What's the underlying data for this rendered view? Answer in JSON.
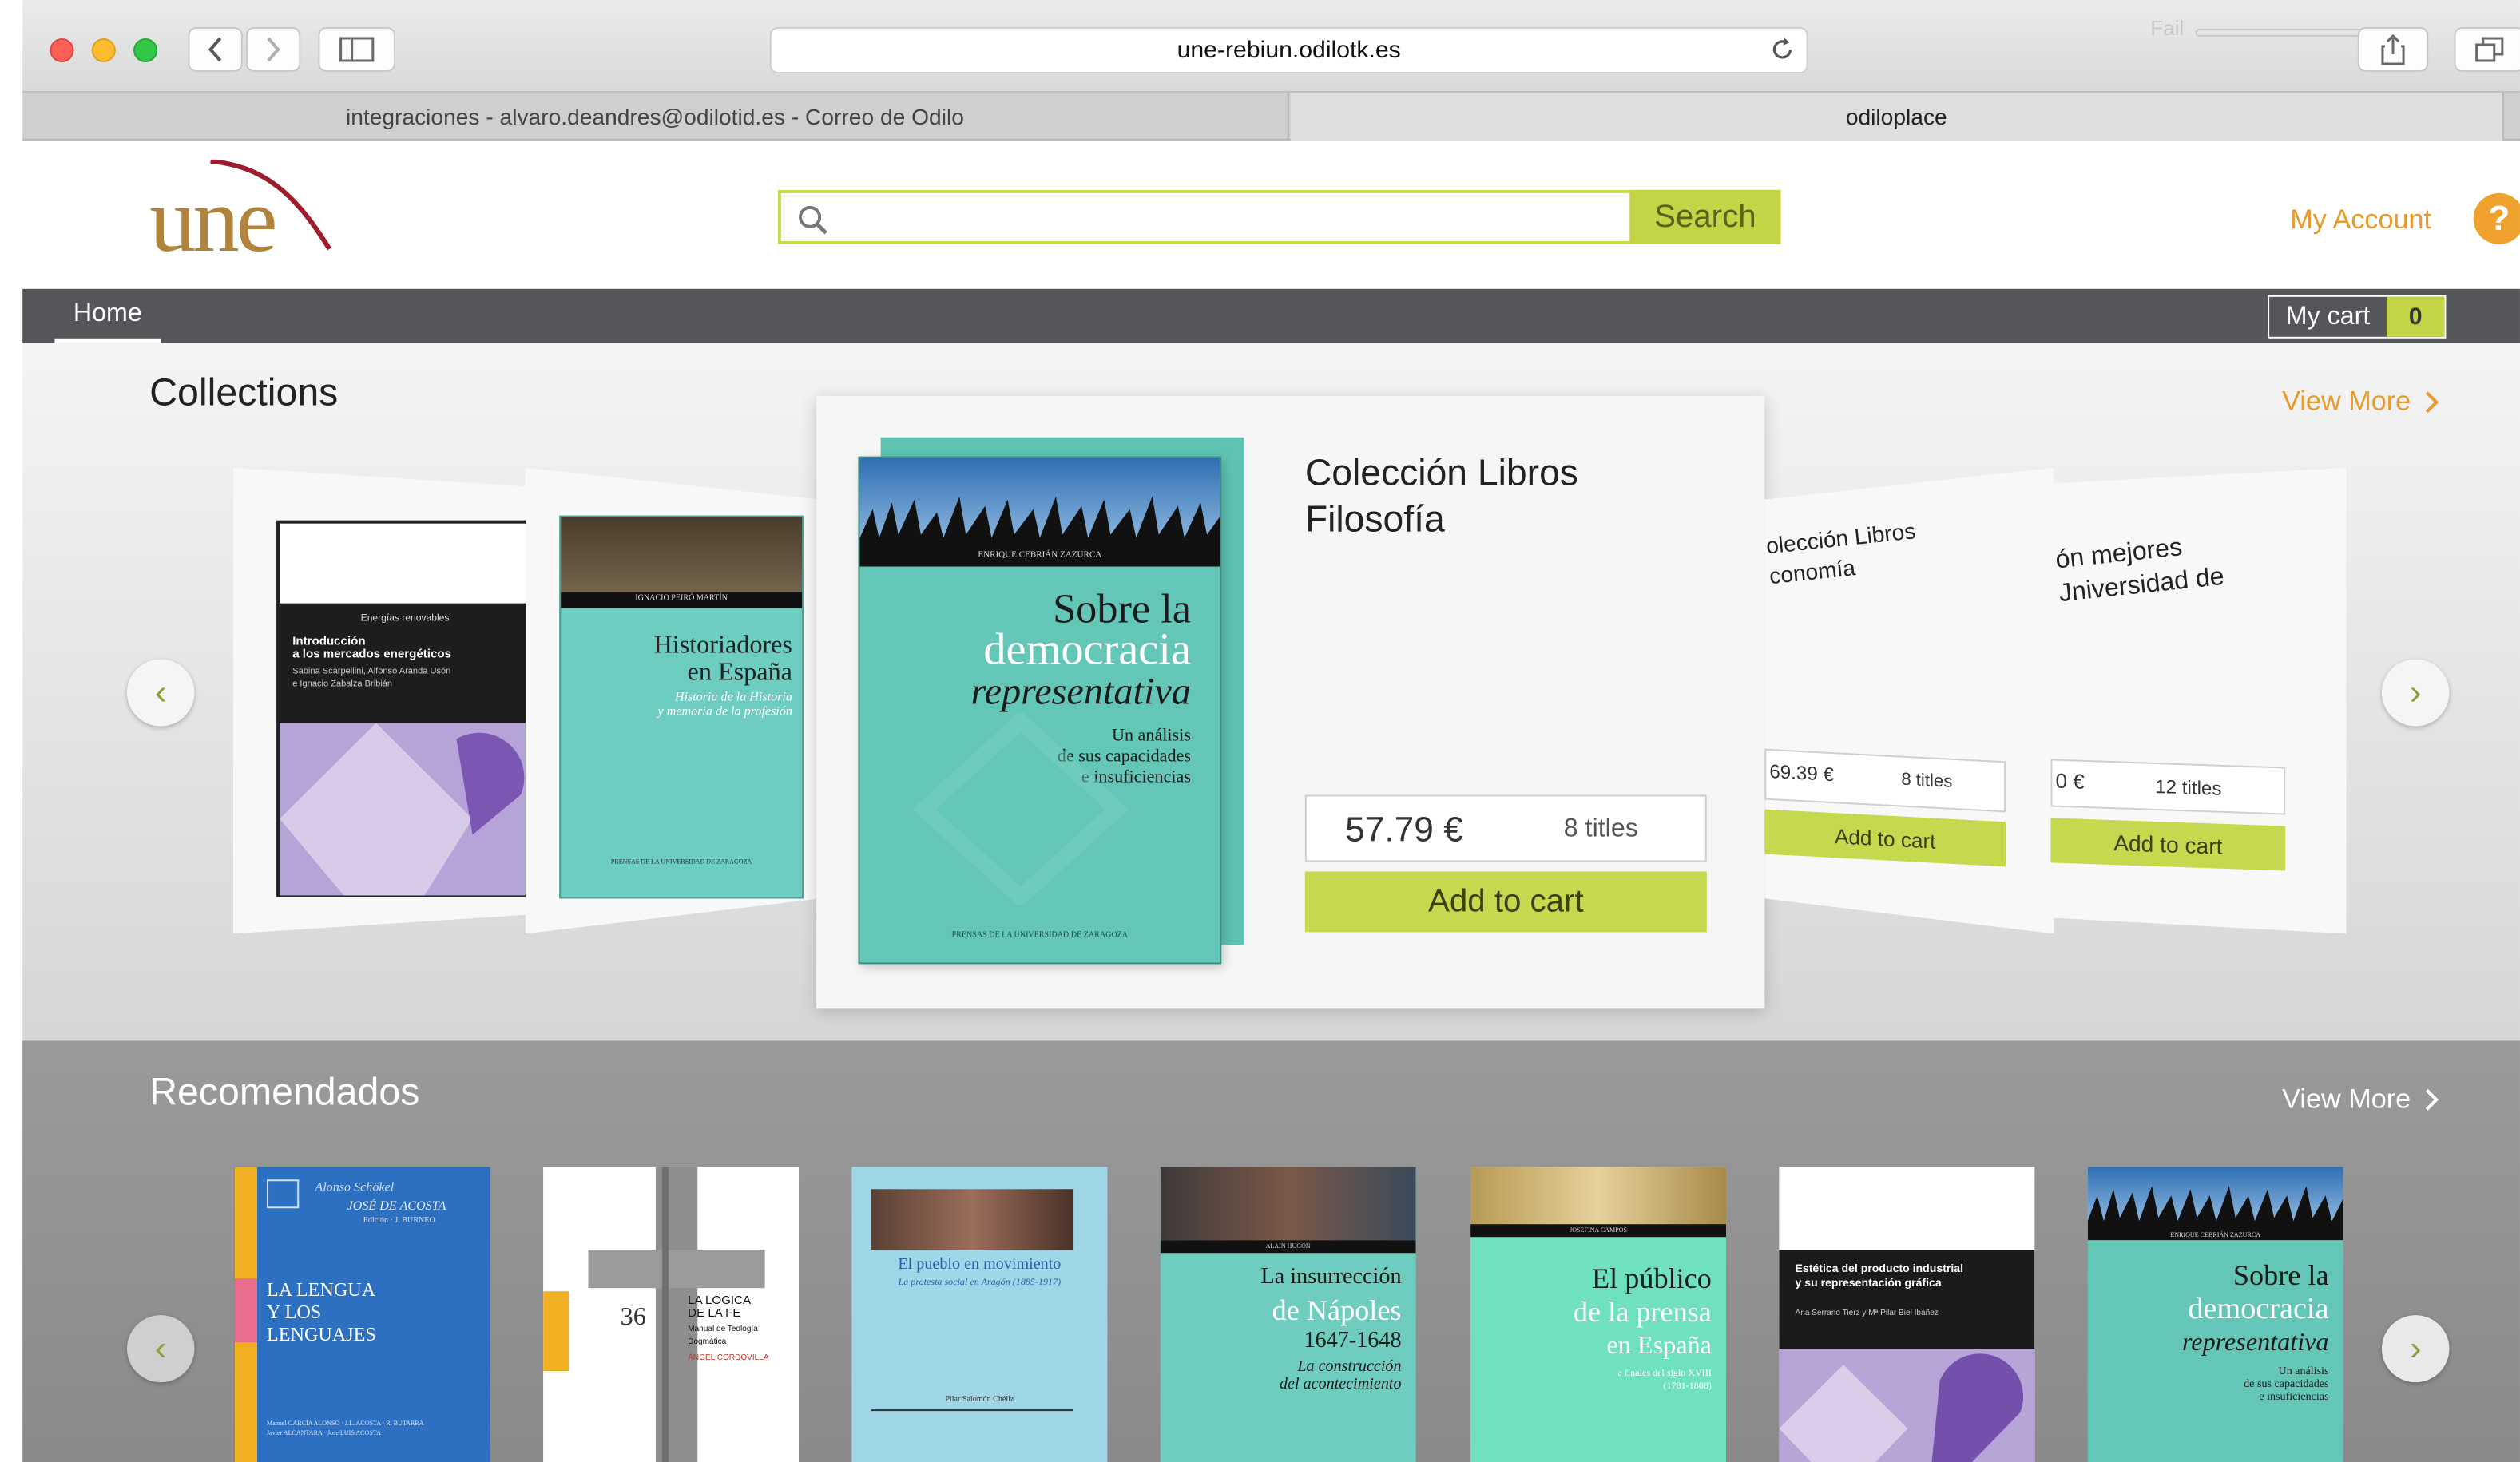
{
  "browser": {
    "url": "une-rebiun.odilotk.es",
    "faint_label": "Fail",
    "tabs": [
      {
        "label": "integraciones - alvaro.deandres@odilotid.es - Correo de Odilo"
      },
      {
        "label": "odiloplace"
      }
    ]
  },
  "site": {
    "logo_text": "une",
    "search": {
      "placeholder": "",
      "button_label": "Search"
    },
    "my_account_label": "My Account",
    "help_label": "?",
    "nav": {
      "home_label": "Home",
      "cart_label": "My cart",
      "cart_count": "0"
    }
  },
  "collections": {
    "title": "Collections",
    "view_more": "View More",
    "featured": {
      "title_line1": "Colección Libros",
      "title_line2": "Filosofía",
      "price": "57.79 €",
      "titles": "8 titles",
      "add_label": "Add to cart",
      "cover": {
        "author": "ENRIQUE CEBRIÁN ZAZURCA",
        "title_1": "Sobre la",
        "title_2": "democracia",
        "title_3": "representativa",
        "subtitle_1": "Un análisis",
        "subtitle_2": "de sus capacidades",
        "subtitle_3": "e insuficiencias",
        "footer": "PRENSAS DE LA UNIVERSIDAD DE ZARAGOZA"
      }
    },
    "left1": {
      "series": "Energías renovables",
      "title_1": "Introducción",
      "title_2": "a los mercados energéticos",
      "authors_1": "Sabina Scarpellini, Alfonso Aranda Usón",
      "authors_2": "e Ignacio Zabalza Bribián"
    },
    "left2": {
      "author": "IGNACIO PEIRÓ MARTÍN",
      "title_1": "Historiadores",
      "title_2": "en España",
      "subtitle_1": "Historia de la Historia",
      "subtitle_2": "y memoria de la profesión",
      "footer": "PRENSAS DE LA UNIVERSIDAD DE ZARAGOZA"
    },
    "right1": {
      "title_1": "olección Libros",
      "title_2": "conomía",
      "price": "69.39 €",
      "titles": "8 titles",
      "add_label": "Add to cart"
    },
    "right2": {
      "title_1": "ón mejores",
      "title_2": "Jniversidad de",
      "price": "0 €",
      "titles": "12 titles",
      "add_label": "Add to cart"
    },
    "prev_arrow": "‹",
    "next_arrow": "›"
  },
  "recomendados": {
    "title": "Recomendados",
    "view_more": "View More",
    "prev_arrow": "‹",
    "next_arrow": "›",
    "books": [
      {
        "top_1": "Alonso Schökel",
        "top_2": "JOSÉ DE ACOSTA",
        "top_3": "Edición · J. BURNEO",
        "title_1": "LA LENGUA",
        "title_2": "Y LOS",
        "title_3": "LENGUAJES",
        "credits_1": "Manuel GARCÍA ALONSO · J.L. ACOSTA · R. BUTARRA",
        "credits_2": "Javier ALCANTARA · Jose LUIS ACOSTA"
      },
      {
        "title_1": "LA LÓGICA",
        "title_2": "DE LA FE",
        "sub_1": "Manual de Teología",
        "sub_2": "Dogmática",
        "author": "ÁNGEL CORDOVILLA",
        "number": "36"
      },
      {
        "title": "El pueblo en movimiento",
        "subtitle": "La protesta social en Aragón (1885-1917)",
        "author": "Pilar Salomón Chéliz"
      },
      {
        "author": "ALAIN HUGON",
        "title_1": "La insurrección",
        "title_2": "de Nápoles",
        "title_3": "1647-1648",
        "sub_1": "La construcción",
        "sub_2": "del acontecimiento"
      },
      {
        "author": "JOSEFINA CAMPOS",
        "title_1": "El público",
        "title_2": "de la prensa",
        "title_3": "en España",
        "sub_1": "a finales del siglo XVIII",
        "sub_2": "(1781-1808)"
      },
      {
        "title_1": "Estética del producto industrial",
        "title_2": "y su representación gráfica",
        "authors": "Ana Serrano Tierz y Mª Pilar Biel Ibáñez"
      },
      {
        "author": "ENRIQUE CEBRIÁN ZAZURCA",
        "title_1": "Sobre la",
        "title_2": "democracia",
        "title_3": "representativa",
        "sub_1": "Un análisis",
        "sub_2": "de sus capacidades",
        "sub_3": "e insuficiencias"
      }
    ]
  },
  "colors": {
    "accent_green": "#c3d546",
    "accent_orange": "#e89b2a",
    "navbar": "#55565a",
    "teal_cover": "#5fc3b3"
  }
}
